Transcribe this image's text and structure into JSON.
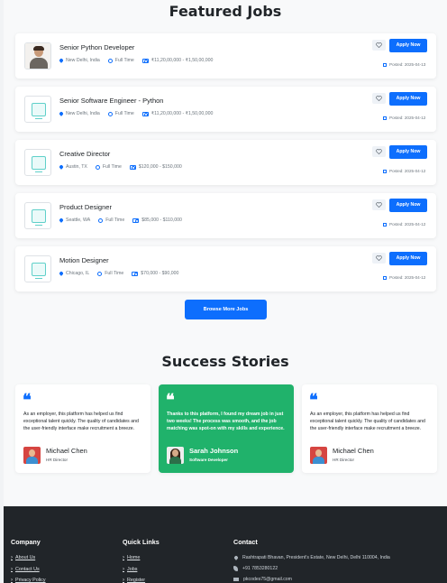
{
  "featured": {
    "title": "Featured Jobs",
    "browse_label": "Browse More Jobs",
    "jobs": [
      {
        "title": "Senior Python Developer",
        "location": "New Delhi, India",
        "type": "Full Time",
        "salary": "₹11,20,00,000 - ₹1,50,00,000",
        "posted": "Posted: 2025-04-13",
        "apply": "Apply Now",
        "logo": "person-photo"
      },
      {
        "title": "Senior Software Engineer - Python",
        "location": "New Delhi, India",
        "type": "Full Time",
        "salary": "₹11,20,00,000 - ₹1,50,00,000",
        "posted": "Posted: 2025-04-12",
        "apply": "Apply Now",
        "logo": "placeholder-image-icon"
      },
      {
        "title": "Creative Director",
        "location": "Austin, TX",
        "type": "Full Time",
        "salary": "$120,000 - $150,000",
        "posted": "Posted: 2025-04-12",
        "apply": "Apply Now",
        "logo": "placeholder-image-icon"
      },
      {
        "title": "Product Designer",
        "location": "Seattle, WA",
        "type": "Full Time",
        "salary": "$85,000 - $110,000",
        "posted": "Posted: 2025-04-12",
        "apply": "Apply Now",
        "logo": "placeholder-image-icon"
      },
      {
        "title": "Motion Designer",
        "location": "Chicago, IL",
        "type": "Full Time",
        "salary": "$70,000 - $90,000",
        "posted": "Posted: 2025-04-12",
        "apply": "Apply Now",
        "logo": "placeholder-image-icon"
      }
    ]
  },
  "stories": {
    "title": "Success Stories",
    "items": [
      {
        "text": "As an employer, this platform has helped us find exceptional talent quickly. The quality of candidates and the user-friendly interface make recruitment a breeze.",
        "name": "Michael Chen",
        "role": "HR Director",
        "highlight": false
      },
      {
        "text": "Thanks to this platform, I found my dream job in just two weeks! The process was smooth, and the job matching was spot-on with my skills and experience.",
        "name": "Sarah Johnson",
        "role": "Software Developer",
        "highlight": true
      },
      {
        "text": "As an employer, this platform has helped us find exceptional talent quickly. The quality of candidates and the user-friendly interface make recruitment a breeze.",
        "name": "Michael Chen",
        "role": "HR Director",
        "highlight": false
      }
    ]
  },
  "footer": {
    "company": {
      "heading": "Company",
      "links": [
        "About Us",
        "Contact Us",
        "Privacy Policy"
      ]
    },
    "quick_links": {
      "heading": "Quick Links",
      "links": [
        "Home",
        "Jobs",
        "Register"
      ]
    },
    "contact": {
      "heading": "Contact",
      "address": "Rashtrapati Bhavan, President's Estate, New Delhi, Delhi 110004, India",
      "phone": "+91 7853280122",
      "email": "pkcodes75@gmail.com"
    }
  },
  "colors": {
    "primary": "#0d6efd",
    "success_card": "#20b26b",
    "footer_bg": "#212529"
  }
}
